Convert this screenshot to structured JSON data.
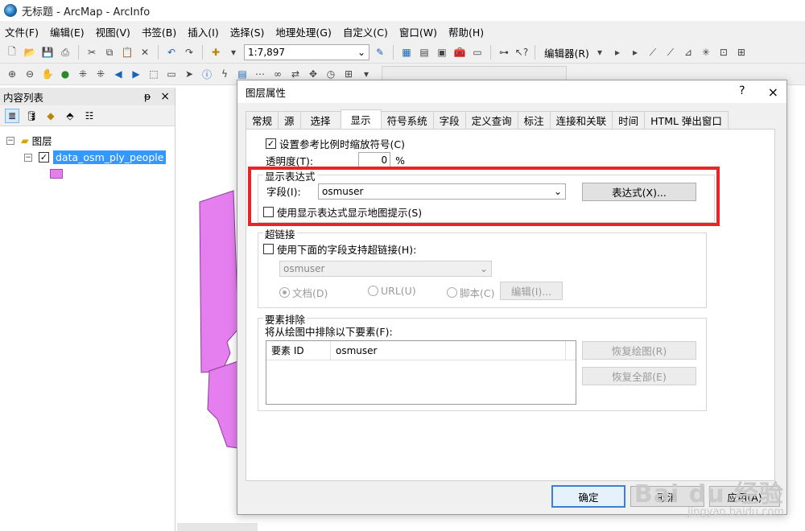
{
  "window": {
    "title": "无标题 - ArcMap - ArcInfo"
  },
  "menu": [
    "文件(F)",
    "编辑(E)",
    "视图(V)",
    "书签(B)",
    "插入(I)",
    "选择(S)",
    "地理处理(G)",
    "自定义(C)",
    "窗口(W)",
    "帮助(H)"
  ],
  "toolbar": {
    "scale": "1:7,897",
    "editor_label": "编辑器(R)"
  },
  "toc": {
    "title": "内容列表",
    "pin": "ᵽ",
    "close": "×",
    "layers_group": "图层",
    "layer_name": "data_osm_ply_people",
    "symbol_color": "#e57ff0"
  },
  "dialog": {
    "title": "图层属性",
    "help": "?",
    "close": "×",
    "tabs": [
      "常规",
      "源",
      "选择",
      "显示",
      "符号系统",
      "字段",
      "定义查询",
      "标注",
      "连接和关联",
      "时间",
      "HTML 弹出窗口"
    ],
    "active_tab": "显示",
    "scale_symbols_label": "设置参考比例时缩放符号(C)",
    "scale_symbols_checked": true,
    "transparency_label": "透明度(T):",
    "transparency_value": "0",
    "transparency_unit": "%",
    "display_expression": {
      "title": "显示表达式",
      "field_label": "字段(I):",
      "field_value": "osmuser",
      "expression_button": "表达式(X)...",
      "maptips_label": "使用显示表达式显示地图提示(S)",
      "maptips_checked": false
    },
    "hyperlinks": {
      "title": "超链接",
      "use_field_label": "使用下面的字段支持超链接(H):",
      "use_field_checked": false,
      "field_value": "osmuser",
      "options": [
        "文档(D)",
        "URL(U)",
        "脚本(C)"
      ],
      "selected_option": "文档(D)",
      "edit_button": "编辑(I)..."
    },
    "feature_exclusion": {
      "title": "要素排除",
      "desc": "将从绘图中排除以下要素(F):",
      "columns": [
        "要素 ID",
        "osmuser"
      ],
      "restore_button": "恢复绘图(R)",
      "restore_all_button": "恢复全部(E)"
    },
    "ok_button": "确定",
    "cancel_button": "取消",
    "apply_button": "应用(A)"
  },
  "watermark": {
    "main": "Bai du 经验",
    "sub": "jingyan.baidu.com"
  },
  "colors": {
    "highlight": "#e8232a",
    "selection": "#3399ff",
    "polygon_fill": "#e57ff0"
  }
}
